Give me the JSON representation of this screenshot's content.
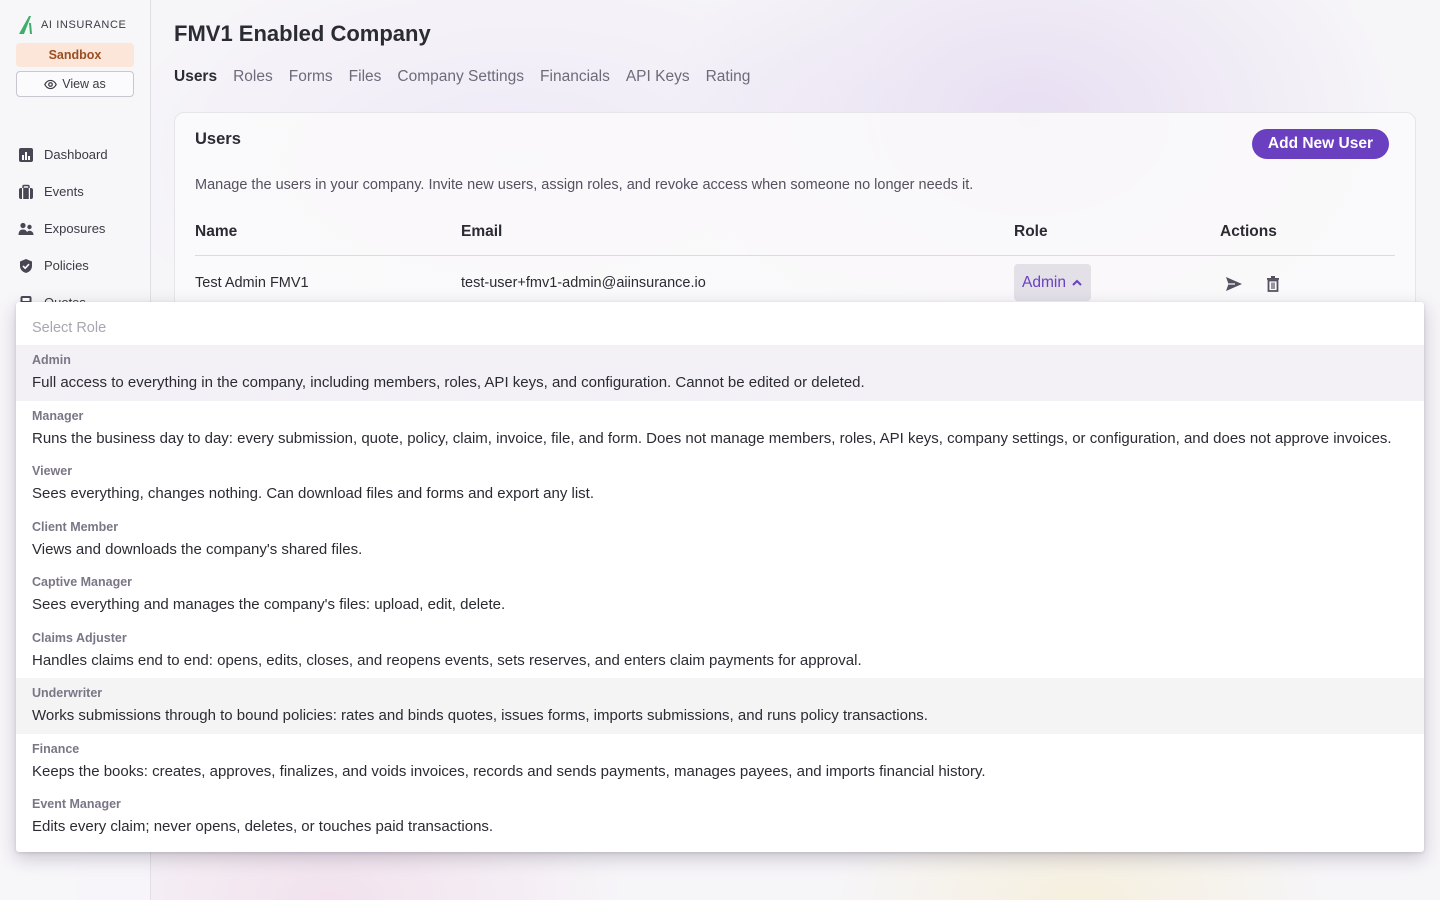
{
  "brand": {
    "logo_text": "AI INSURANCE",
    "accent": "#6a3fc0",
    "logo_green": "#3fae6a"
  },
  "sidebar": {
    "sandbox_label": "Sandbox",
    "view_as_label": "View as",
    "items": [
      {
        "label": "Dashboard",
        "icon": "bar-chart-icon"
      },
      {
        "label": "Events",
        "icon": "briefcase-icon"
      },
      {
        "label": "Exposures",
        "icon": "people-icon"
      },
      {
        "label": "Policies",
        "icon": "shield-check-icon"
      },
      {
        "label": "Quotes",
        "icon": "calculator-icon"
      }
    ]
  },
  "header": {
    "company_title": "FMV1 Enabled Company"
  },
  "tabs": [
    {
      "label": "Users",
      "active": true
    },
    {
      "label": "Roles",
      "active": false
    },
    {
      "label": "Forms",
      "active": false
    },
    {
      "label": "Files",
      "active": false
    },
    {
      "label": "Company Settings",
      "active": false
    },
    {
      "label": "Financials",
      "active": false
    },
    {
      "label": "API Keys",
      "active": false
    },
    {
      "label": "Rating",
      "active": false
    }
  ],
  "users_card": {
    "title": "Users",
    "add_button_label": "Add New User",
    "description": "Manage the users in your company. Invite new users, assign roles, and revoke access when someone no longer needs it.",
    "columns": [
      "Name",
      "Email",
      "Role",
      "Actions"
    ],
    "rows": [
      {
        "name": "Test Admin FMV1",
        "email": "test-user+fmv1-admin@aiinsurance.io",
        "role": "Admin"
      }
    ]
  },
  "role_dropdown": {
    "placeholder": "Select Role",
    "selected": "Admin",
    "options": [
      {
        "label": "Admin",
        "description": "Full access to everything in the company, including members, roles, API keys, and configuration. Cannot be edited or deleted."
      },
      {
        "label": "Manager",
        "description": "Runs the business day to day: every submission, quote, policy, claim, invoice, file, and form. Does not manage members, roles, API keys, company settings, or configuration, and does not approve invoices."
      },
      {
        "label": "Viewer",
        "description": "Sees everything, changes nothing. Can download files and forms and export any list."
      },
      {
        "label": "Client Member",
        "description": "Views and downloads the company's shared files."
      },
      {
        "label": "Captive Manager",
        "description": "Sees everything and manages the company's files: upload, edit, delete."
      },
      {
        "label": "Claims Adjuster",
        "description": "Handles claims end to end: opens, edits, closes, and reopens events, sets reserves, and enters claim payments for approval."
      },
      {
        "label": "Underwriter",
        "description": "Works submissions through to bound policies: rates and binds quotes, issues forms, imports submissions, and runs policy transactions."
      },
      {
        "label": "Finance",
        "description": "Keeps the books: creates, approves, finalizes, and voids invoices, records and sends payments, manages payees, and imports financial history."
      },
      {
        "label": "Event Manager",
        "description": "Edits every claim; never opens, deletes, or touches paid transactions."
      }
    ]
  }
}
